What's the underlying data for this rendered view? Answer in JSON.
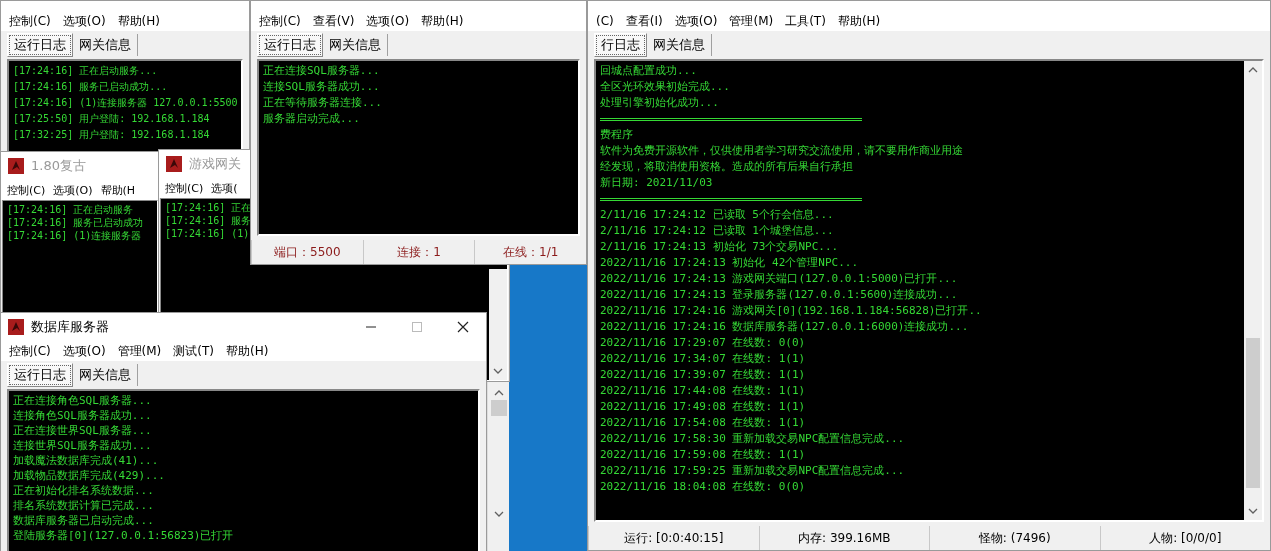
{
  "windows": [
    {
      "menu": [
        "控制(C)",
        "选项(O)",
        "帮助(H)"
      ],
      "tabs": [
        {
          "label": "运行日志",
          "selected": true
        },
        {
          "label": "网关信息",
          "selected": false
        }
      ],
      "log": [
        "[17:24:16] 正在启动服务...",
        "[17:24:16] 服务已启动成功...",
        "[17:24:16] (1)连接服务器 127.0.0.1:5500",
        "[17:25:50] 用户登陆: 192.168.1.184",
        "[17:32:25] 用户登陆: 192.168.1.184"
      ]
    },
    {
      "menu": [
        "控制(C)",
        "查看(V)",
        "选项(O)",
        "帮助(H)"
      ],
      "tabs": [
        {
          "label": "运行日志",
          "selected": true
        },
        {
          "label": "网关信息",
          "selected": false
        }
      ],
      "log": [
        "正在连接SQL服务器...",
        "连接SQL服务器成功...",
        "正在等待服务器连接...",
        "服务器启动完成..."
      ],
      "status": [
        "端口：5500",
        "连接：1",
        "在线：1/1"
      ]
    },
    {
      "menu": [
        "(C)",
        "查看(I)",
        "选项(O)",
        "管理(M)",
        "工具(T)",
        "帮助(H)"
      ],
      "tabs": [
        {
          "label": "行日志",
          "selected": true
        },
        {
          "label": "网关信息",
          "selected": false
        }
      ],
      "log": [
        {
          "kind": "text",
          "text": "回城点配置成功..."
        },
        {
          "kind": "text",
          "text": "全区光环效果初始完成..."
        },
        {
          "kind": "text",
          "text": "处理引擎初始化成功..."
        },
        {
          "kind": "rule"
        },
        {
          "kind": "text",
          "text": "费程序"
        },
        {
          "kind": "text",
          "text": "软件为免费开源软件，仅供使用者学习研究交流使用，请不要用作商业用途"
        },
        {
          "kind": "text",
          "text": "经发现，将取消使用资格。造成的所有后果自行承担"
        },
        {
          "kind": "text",
          "text": "新日期: 2021/11/03"
        },
        {
          "kind": "rule"
        },
        {
          "kind": "text",
          "text": "2/11/16 17:24:12 已读取 5个行会信息..."
        },
        {
          "kind": "text",
          "text": "2/11/16 17:24:12 已读取 1个城堡信息..."
        },
        {
          "kind": "text",
          "text": "2/11/16 17:24:13 初始化 73个交易NPC..."
        },
        {
          "kind": "text",
          "text": "2022/11/16 17:24:13 初始化 42个管理NPC..."
        },
        {
          "kind": "text",
          "text": "2022/11/16 17:24:13 游戏网关端口(127.0.0.1:5000)已打开..."
        },
        {
          "kind": "text",
          "text": "2022/11/16 17:24:13 登录服务器(127.0.0.1:5600)连接成功..."
        },
        {
          "kind": "text",
          "text": "2022/11/16 17:24:16 游戏网关[0](192.168.1.184:56828)已打开.."
        },
        {
          "kind": "text",
          "text": "2022/11/16 17:24:16 数据库服务器(127.0.0.1:6000)连接成功..."
        },
        {
          "kind": "text",
          "text": "2022/11/16 17:29:07 在线数: 0(0)"
        },
        {
          "kind": "text",
          "text": "2022/11/16 17:34:07 在线数: 1(1)"
        },
        {
          "kind": "text",
          "text": "2022/11/16 17:39:07 在线数: 1(1)"
        },
        {
          "kind": "text",
          "text": "2022/11/16 17:44:08 在线数: 1(1)"
        },
        {
          "kind": "text",
          "text": "2022/11/16 17:49:08 在线数: 1(1)"
        },
        {
          "kind": "text",
          "text": "2022/11/16 17:54:08 在线数: 1(1)"
        },
        {
          "kind": "text",
          "text": "2022/11/16 17:58:30 重新加载交易NPC配置信息完成..."
        },
        {
          "kind": "text",
          "text": "2022/11/16 17:59:08 在线数: 1(1)"
        },
        {
          "kind": "text",
          "text": "2022/11/16 17:59:25 重新加载交易NPC配置信息完成..."
        },
        {
          "kind": "text",
          "text": "2022/11/16 18:04:08 在线数: 0(0)"
        }
      ],
      "status": [
        "运行: [0:0:40:15]",
        "内存: 399.16MB",
        "怪物: (7496)",
        "人物: [0/0/0]"
      ]
    },
    {
      "title": "1.80复古",
      "menu": [
        "控制(C)",
        "选项(O)",
        "帮助(H"
      ],
      "log": [
        "[17:24:16] 正在启动服务",
        "[17:24:16] 服务已启动成功",
        "[17:24:16] (1)连接服务器"
      ]
    },
    {
      "title": "游戏网关",
      "menu": [
        "控制(C)",
        "选项("
      ],
      "log": [
        "[17:24:16] 正在",
        "[17:24:16] 服务",
        "[17:24:16] (1)"
      ]
    },
    {
      "title": "数据库服务器",
      "menu": [
        "控制(C)",
        "选项(O)",
        "管理(M)",
        "测试(T)",
        "帮助(H)"
      ],
      "tabs": [
        {
          "label": "运行日志",
          "selected": true
        },
        {
          "label": "网关信息",
          "selected": false
        }
      ],
      "log": [
        "正在连接角色SQL服务器...",
        "连接角色SQL服务器成功...",
        "正在连接世界SQL服务器...",
        "连接世界SQL服务器成功...",
        "加载魔法数据库完成(41)...",
        "加载物品数据库完成(429)...",
        "正在初始化排名系统数据...",
        "排名系统数据计算已完成...",
        "数据库服务器已启动完成...",
        "登陆服务器[0](127.0.0.1:56823)已打开"
      ]
    }
  ]
}
